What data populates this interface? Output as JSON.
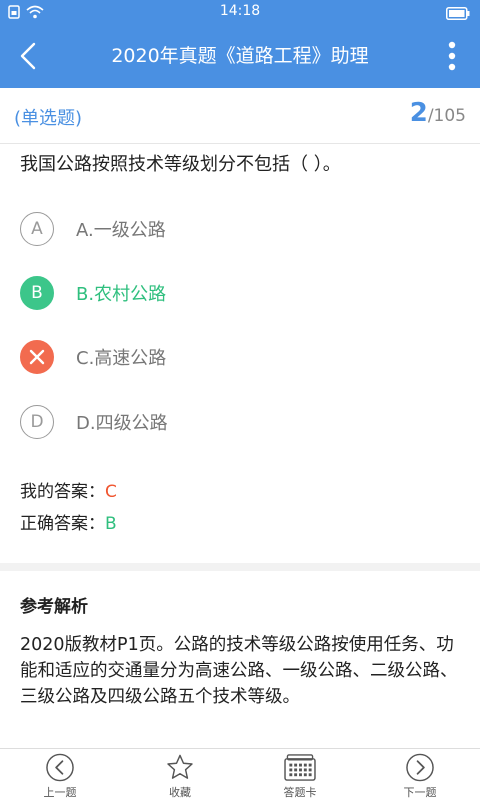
{
  "status_bar": {
    "time": "14:18"
  },
  "header": {
    "title": "2020年真题《道路工程》助理"
  },
  "question": {
    "type_label": "(单选题)",
    "current": "2",
    "total": "/105",
    "stem": "我国公路按照技术等级划分不包括（ ）。",
    "options": [
      {
        "letter": "A",
        "text": "A.一级公路",
        "state": "normal"
      },
      {
        "letter": "B",
        "text": "B.农村公路",
        "state": "correct"
      },
      {
        "letter": "C",
        "text": "C.高速公路",
        "state": "wrong"
      },
      {
        "letter": "D",
        "text": "D.四级公路",
        "state": "normal"
      }
    ]
  },
  "answers": {
    "my_label": "我的答案：",
    "my_value": "C",
    "correct_label": "正确答案：",
    "correct_value": "B"
  },
  "analysis": {
    "title": "参考解析",
    "body": "2020版教材P1页。公路的技术等级公路按使用任务、功能和适应的交通量分为高速公路、一级公路、二级公路、三级公路及四级公路五个技术等级。"
  },
  "bottom_nav": {
    "prev": "上一题",
    "favorite": "收藏",
    "answer_card": "答题卡",
    "next": "下一题"
  },
  "colors": {
    "primary": "#4a90e2",
    "correct": "#3cc68a",
    "wrong": "#f26b4f"
  }
}
